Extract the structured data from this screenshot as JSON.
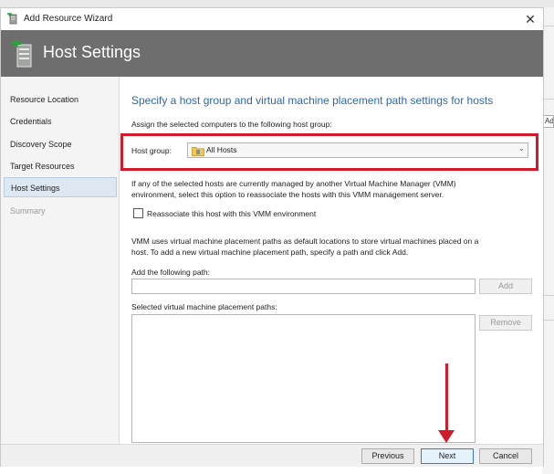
{
  "window": {
    "title": "Add Resource Wizard"
  },
  "banner": {
    "title": "Host Settings"
  },
  "sidebar": {
    "items": [
      {
        "label": "Resource Location"
      },
      {
        "label": "Credentials"
      },
      {
        "label": "Discovery Scope"
      },
      {
        "label": "Target Resources"
      },
      {
        "label": "Host Settings"
      },
      {
        "label": "Summary"
      }
    ]
  },
  "main": {
    "heading": "Specify a host group and virtual machine placement path settings for hosts",
    "assign_label": "Assign the selected computers to the following host group:",
    "host_group_label": "Host group:",
    "host_group_value": "All Hosts",
    "reassociate_text_1": "If any of the selected hosts are currently managed by another Virtual Machine Manager (VMM)",
    "reassociate_text_2": "environment, select this option to reassociate the hosts with this VMM management server.",
    "reassociate_checkbox_label": "Reassociate this host with this VMM environment",
    "reassociate_checked": false,
    "vmm_text_1": "VMM uses virtual machine placement paths as default locations to store virtual machines placed on a",
    "vmm_text_2": "host. To add a new virtual machine placement path, specify a path and click Add.",
    "add_path_label": "Add the following path:",
    "add_path_value": "",
    "add_button": "Add",
    "selected_paths_label": "Selected virtual machine placement paths:",
    "remove_button": "Remove"
  },
  "footer": {
    "previous": "Previous",
    "next": "Next",
    "cancel": "Cancel"
  },
  "background": {
    "partial_button": "Add"
  },
  "colors": {
    "banner": "#6e6e6e",
    "heading": "#2f67a9",
    "highlight": "#d11a2a",
    "active_nav": "#dde8f3"
  }
}
